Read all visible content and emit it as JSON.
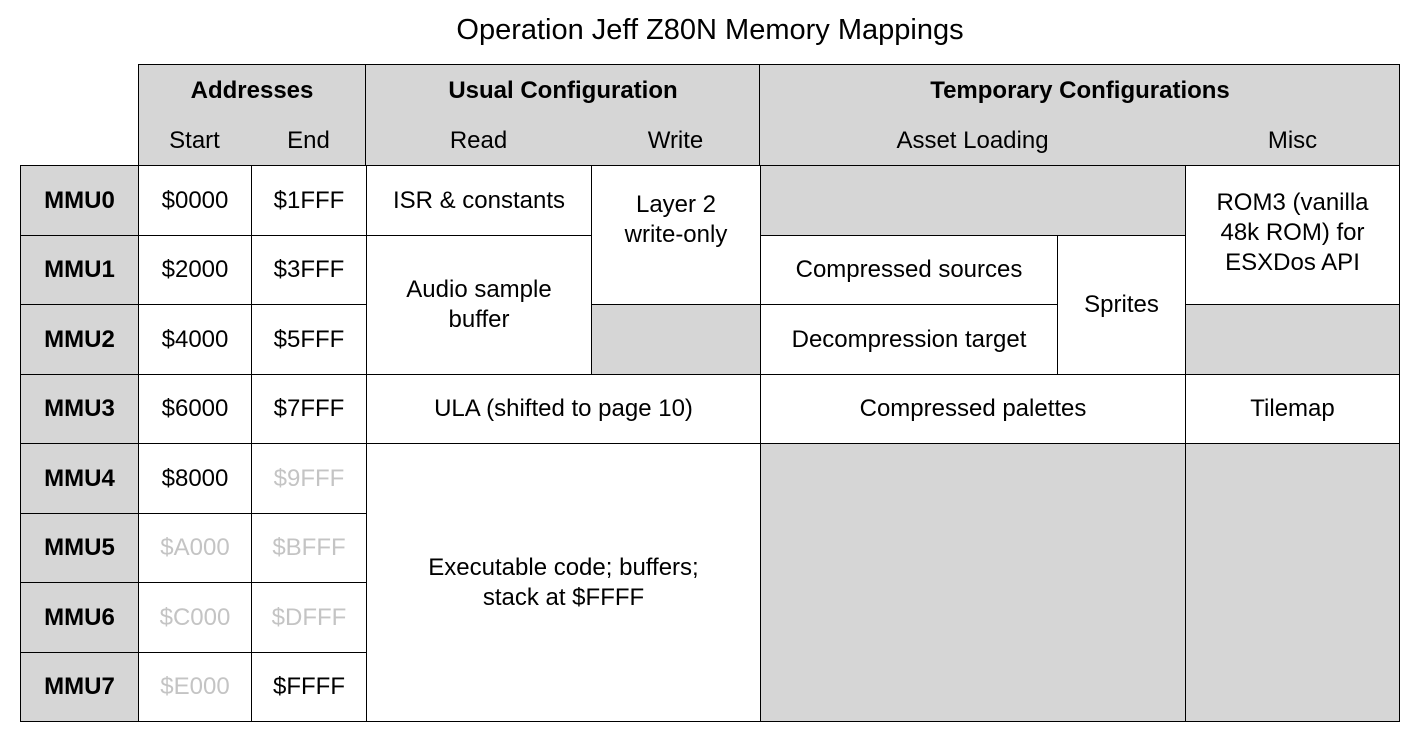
{
  "title": "Operation Jeff Z80N Memory Mappings",
  "colors": {
    "shaded": "#d6d6d6",
    "border": "#000000",
    "faded_text": "#c4c4c4"
  },
  "header": {
    "addresses": "Addresses",
    "start": "Start",
    "end": "End",
    "usual": "Usual Configuration",
    "read": "Read",
    "write": "Write",
    "temporary": "Temporary Configurations",
    "asset_loading": "Asset Loading",
    "misc": "Misc"
  },
  "rows": [
    {
      "mmu": "MMU0",
      "start": "$0000",
      "end": "$1FFF"
    },
    {
      "mmu": "MMU1",
      "start": "$2000",
      "end": "$3FFF"
    },
    {
      "mmu": "MMU2",
      "start": "$4000",
      "end": "$5FFF"
    },
    {
      "mmu": "MMU3",
      "start": "$6000",
      "end": "$7FFF"
    },
    {
      "mmu": "MMU4",
      "start": "$8000",
      "end": "$9FFF"
    },
    {
      "mmu": "MMU5",
      "start": "$A000",
      "end": "$BFFF"
    },
    {
      "mmu": "MMU6",
      "start": "$C000",
      "end": "$DFFF"
    },
    {
      "mmu": "MMU7",
      "start": "$E000",
      "end": "$FFFF"
    }
  ],
  "cells": {
    "isr": "ISR & constants",
    "layer2": "Layer 2 write-only",
    "audio": "Audio sample buffer",
    "ula": "ULA (shifted to page 10)",
    "exec": "Executable code; buffers; stack at $FFFF",
    "compressed_sources": "Compressed sources",
    "decompression_target": "Decompression target",
    "sprites": "Sprites",
    "compressed_palettes": "Compressed palettes",
    "rom3": "ROM3 (vanilla 48k ROM) for ESXDos API",
    "tilemap": "Tilemap"
  }
}
